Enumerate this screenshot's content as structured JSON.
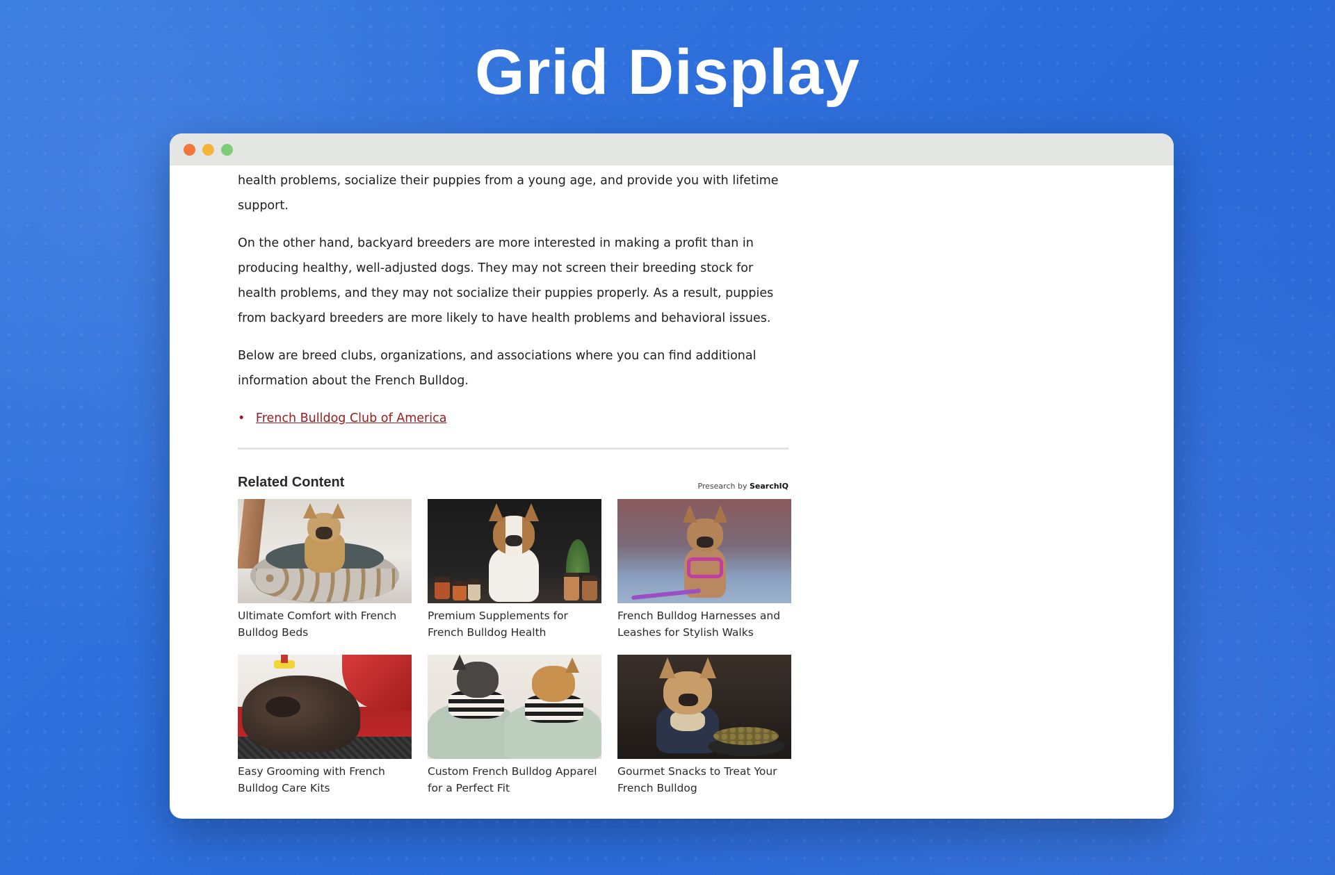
{
  "hero": {
    "title": "Grid Display"
  },
  "article": {
    "paragraphs": [
      "health problems, socialize their puppies from a young age, and provide you with lifetime support.",
      "On the other hand, backyard breeders are more interested in making a profit than in producing healthy, well-adjusted dogs. They may not screen their breeding stock for health problems, and they may not socialize their puppies properly. As a result, puppies from backyard breeders are more likely to have health problems and behavioral issues.",
      "Below are breed clubs, organizations, and associations where you can find additional information about the French Bulldog."
    ],
    "links": [
      {
        "label": "French Bulldog Club of America"
      }
    ]
  },
  "related": {
    "heading": "Related Content",
    "powered_prefix": "Presearch by",
    "powered_brand": "SearchIQ",
    "cards": [
      {
        "title": "Ultimate Comfort with French Bulldog Beds",
        "image": "dog-in-bed"
      },
      {
        "title": "Premium Supplements for French Bulldog Health",
        "image": "dog-with-supplements"
      },
      {
        "title": "French Bulldog Harnesses and Leashes for Stylish Walks",
        "image": "dog-in-harness"
      },
      {
        "title": "Easy Grooming with French Bulldog Care Kits",
        "image": "dog-being-brushed"
      },
      {
        "title": "Custom French Bulldog Apparel for a Perfect Fit",
        "image": "dogs-in-sweaters"
      },
      {
        "title": "Gourmet Snacks to Treat Your French Bulldog",
        "image": "dog-with-food-bowl"
      }
    ]
  },
  "colors": {
    "background": "#2f6fdc",
    "link": "#9b1c20",
    "titlebar": "#e4e6e3"
  }
}
